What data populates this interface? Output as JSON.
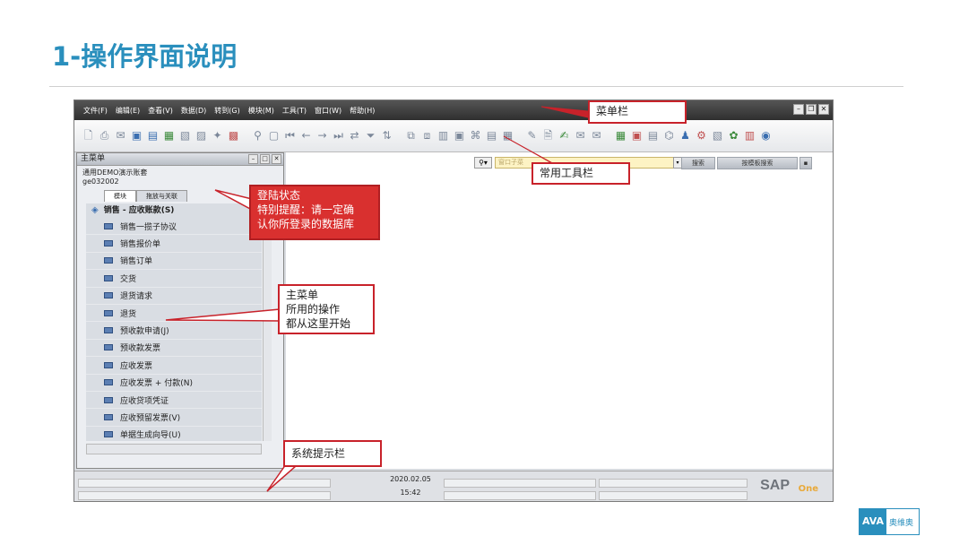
{
  "slide": {
    "title": "1-操作界面说明"
  },
  "menubar": {
    "items": [
      "文件(F)",
      "编辑(E)",
      "查看(V)",
      "数据(D)",
      "转到(G)",
      "模块(M)",
      "工具(T)",
      "窗口(W)",
      "帮助(H)"
    ]
  },
  "workspace": {
    "search_placeholder": "窗口子菜",
    "search_btn_label": "搜索",
    "search_scope_label": "按模板搜索"
  },
  "main_menu": {
    "title": "主菜单",
    "company": "通用DEMO演示账套",
    "user": "ge032002",
    "tabs": [
      "模块",
      "拖放与关联"
    ],
    "section": "销售 - 应收账款(S)",
    "items": [
      "销售一揽子协议",
      "销售报价单",
      "销售订单",
      "交货",
      "退货请求",
      "退货",
      "预收款申请(J)",
      "预收款发票",
      "应收发票",
      "应收发票 + 付款(N)",
      "应收贷项凭证",
      "应收预留发票(V)",
      "单据生成向导(U)"
    ]
  },
  "status": {
    "date": "2020.02.05",
    "time": "15:42",
    "brand": "SAP",
    "brand_sub": "One"
  },
  "callouts": {
    "menubar": "菜单栏",
    "toolbar": "常用工具栏",
    "login_l1": "登陆状态",
    "login_l2": "特别提醒：请一定确",
    "login_l3": "认你所登录的数据库",
    "mainmenu_l1": "主菜单",
    "mainmenu_l2": "所用的操作",
    "mainmenu_l3": "都从这里开始",
    "statusbar": "系统提示栏"
  },
  "logo": {
    "mark": "AVA",
    "text": "奥维奥"
  },
  "colors": {
    "title": "#2a8fbd",
    "callout_border": "#c8222a",
    "callout_fill": "#d9302f"
  }
}
